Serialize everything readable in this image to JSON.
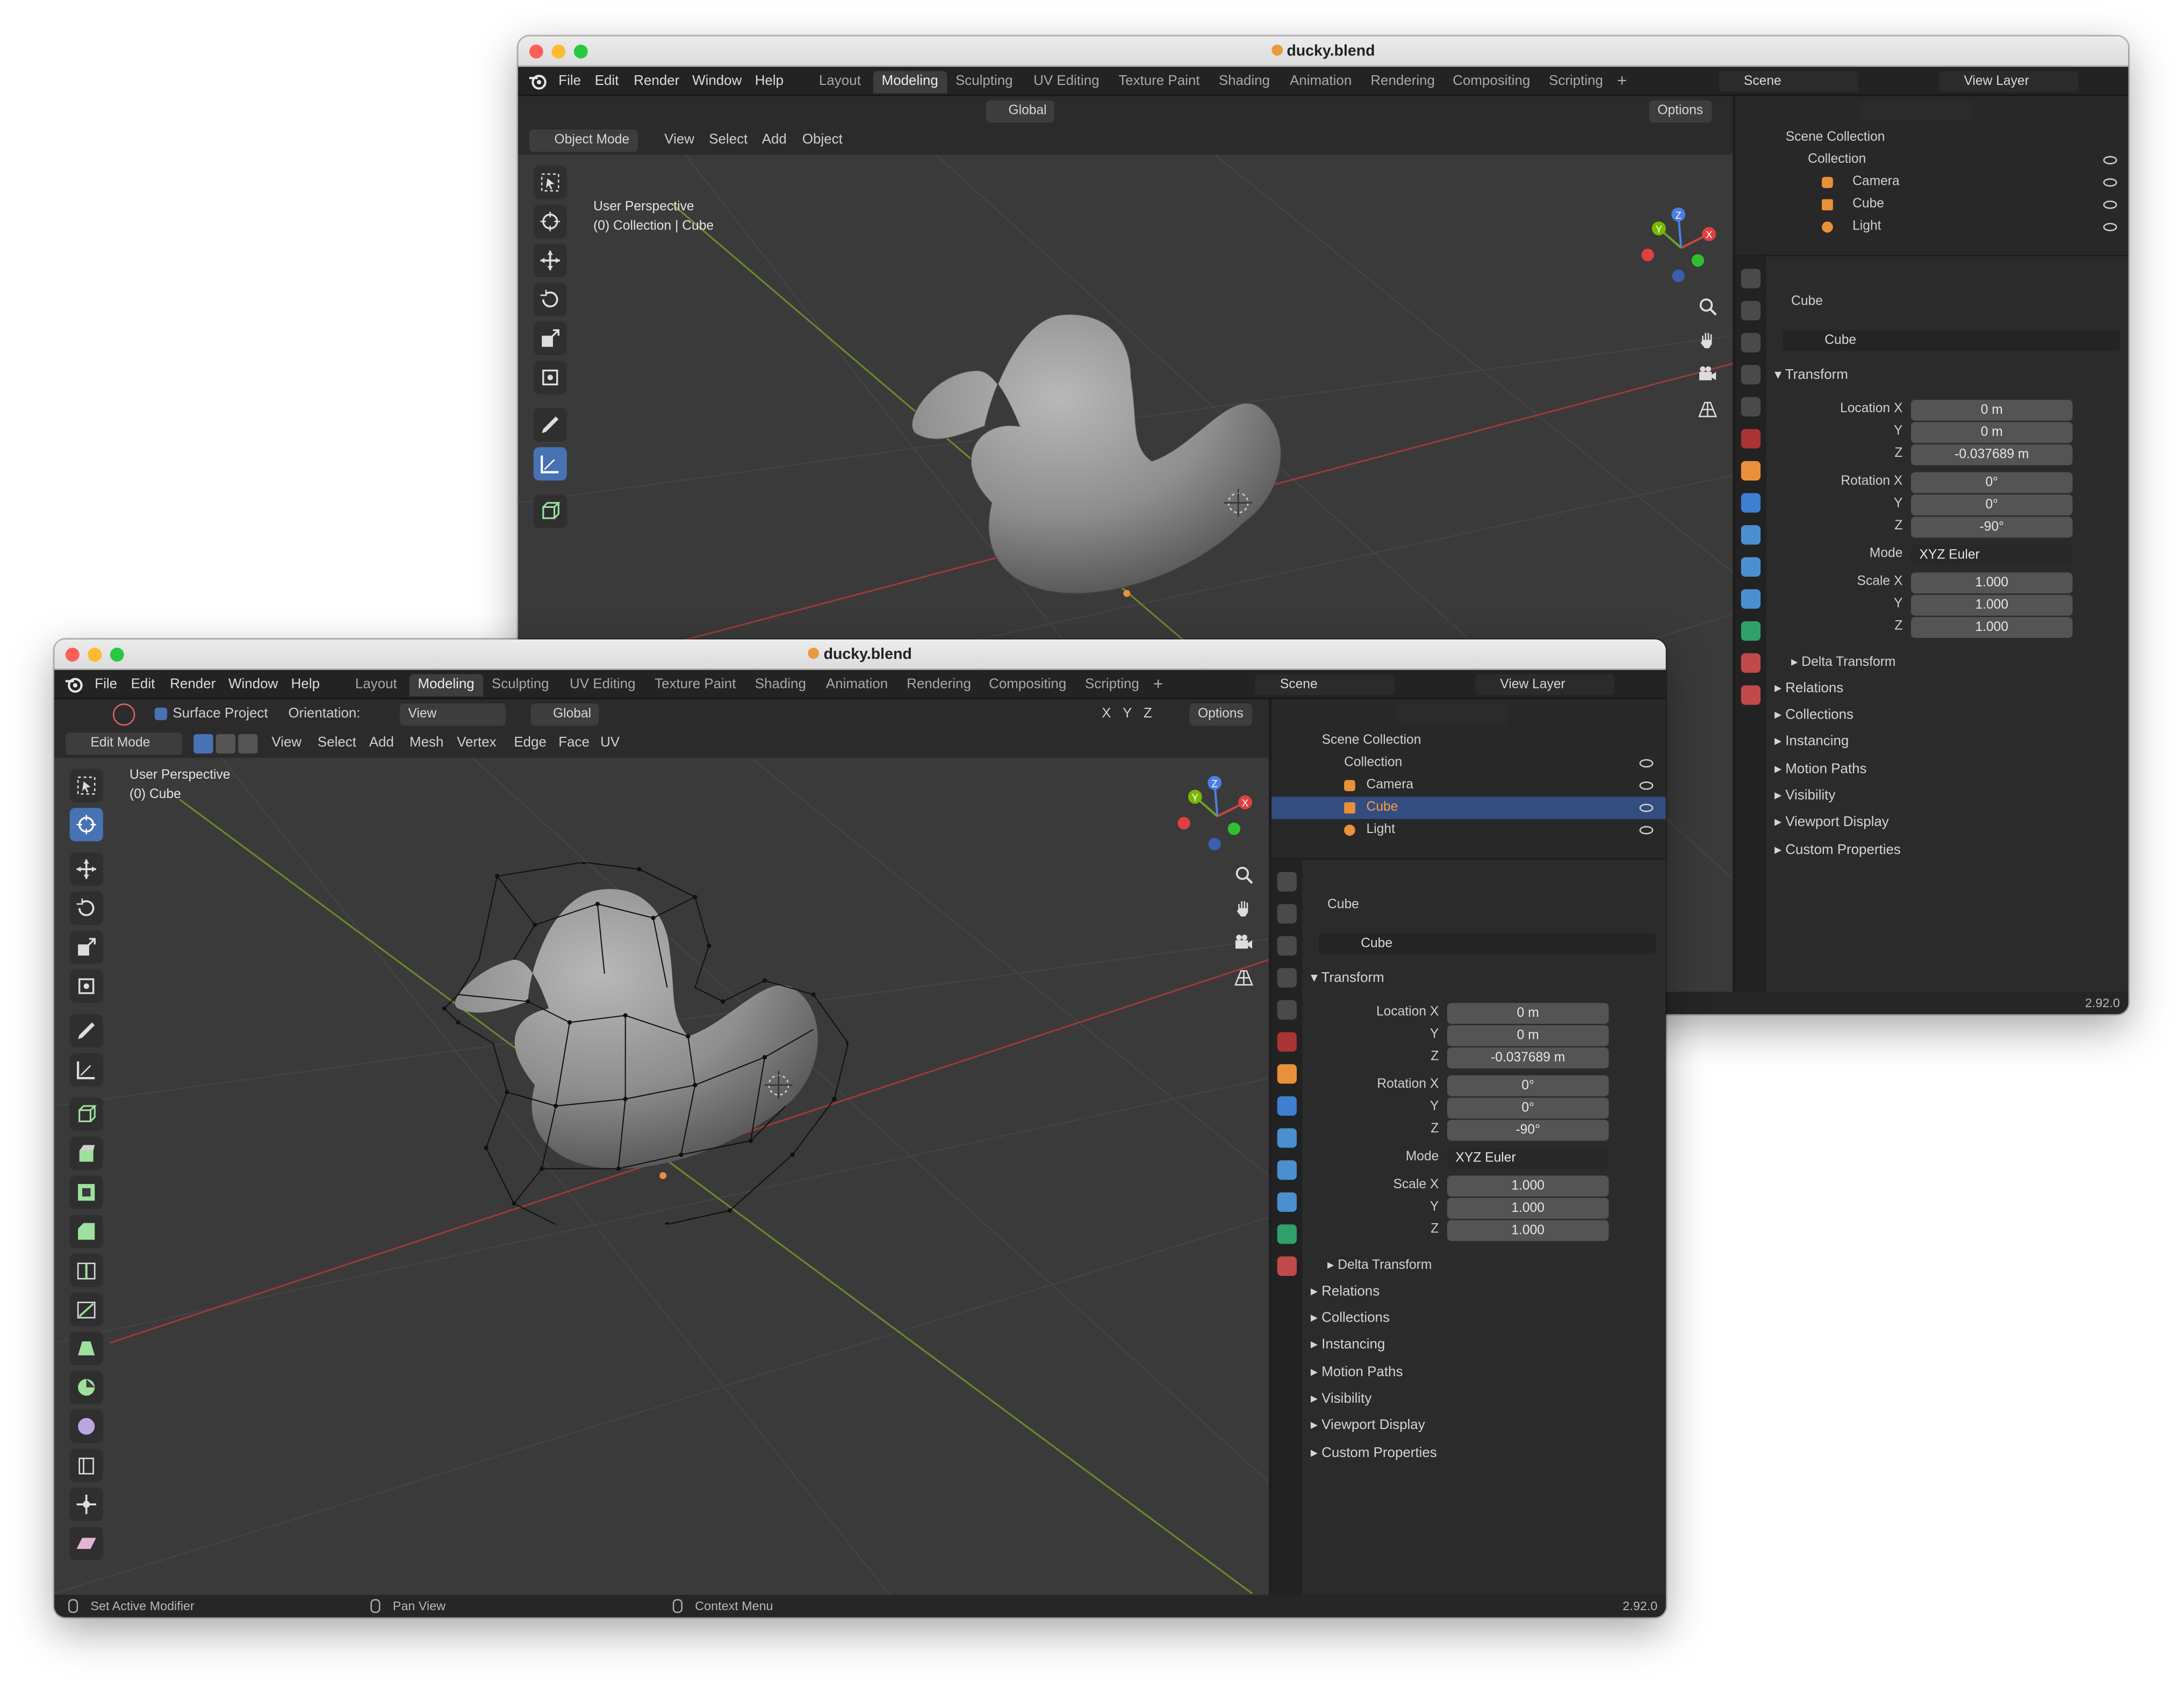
{
  "back": {
    "title": "ducky.blend",
    "menus": [
      "File",
      "Edit",
      "Render",
      "Window",
      "Help"
    ],
    "tabs": [
      "Layout",
      "Modeling",
      "Sculpting",
      "UV Editing",
      "Texture Paint",
      "Shading",
      "Animation",
      "Rendering",
      "Compositing",
      "Scripting"
    ],
    "active_tab": "Modeling",
    "scene": "Scene",
    "view_layer": "View Layer",
    "transform_orientation": "Global",
    "options": "Options",
    "mode": "Object Mode",
    "header_menus": [
      "View",
      "Select",
      "Add",
      "Object"
    ],
    "vp_line1": "User Perspective",
    "vp_line2": "(0) Collection | Cube",
    "outliner": {
      "scene_collection": "Scene Collection",
      "collection": "Collection",
      "items": [
        "Camera",
        "Cube",
        "Light"
      ]
    },
    "props": {
      "object_name": "Cube",
      "data_name": "Cube",
      "transform": "Transform",
      "location_label": "Location X",
      "loc": [
        "0 m",
        "0 m",
        "-0.037689 m"
      ],
      "rotation_label": "Rotation X",
      "rot": [
        "0°",
        "0°",
        "-90°"
      ],
      "mode_label": "Mode",
      "mode_value": "XYZ Euler",
      "scale_label": "Scale X",
      "scale": [
        "1.000",
        "1.000",
        "1.000"
      ],
      "y": "Y",
      "z": "Z",
      "delta": "Delta Transform",
      "sections": [
        "Relations",
        "Collections",
        "Instancing",
        "Motion Paths",
        "Visibility",
        "Viewport Display",
        "Custom Properties"
      ]
    },
    "version": "2.92.0"
  },
  "front": {
    "title": "ducky.blend",
    "menus": [
      "File",
      "Edit",
      "Render",
      "Window",
      "Help"
    ],
    "tabs": [
      "Layout",
      "Modeling",
      "Sculpting",
      "UV Editing",
      "Texture Paint",
      "Shading",
      "Animation",
      "Rendering",
      "Compositing",
      "Scripting"
    ],
    "active_tab": "Modeling",
    "scene": "Scene",
    "view_layer": "View Layer",
    "surface_project": "Surface Project",
    "orientation_label": "Orientation:",
    "orientation_value": "View",
    "transform_orientation": "Global",
    "xyz": [
      "X",
      "Y",
      "Z"
    ],
    "options": "Options",
    "mode": "Edit Mode",
    "header_menus": [
      "View",
      "Select",
      "Add",
      "Mesh",
      "Vertex",
      "Edge",
      "Face",
      "UV"
    ],
    "vp_line1": "User Perspective",
    "vp_line2": "(0) Cube",
    "outliner": {
      "scene_collection": "Scene Collection",
      "collection": "Collection",
      "items": [
        "Camera",
        "Cube",
        "Light"
      ]
    },
    "props": {
      "object_name": "Cube",
      "data_name": "Cube",
      "transform": "Transform",
      "location_label": "Location X",
      "loc": [
        "0 m",
        "0 m",
        "-0.037689 m"
      ],
      "rotation_label": "Rotation X",
      "rot": [
        "0°",
        "0°",
        "-90°"
      ],
      "mode_label": "Mode",
      "mode_value": "XYZ Euler",
      "scale_label": "Scale X",
      "scale": [
        "1.000",
        "1.000",
        "1.000"
      ],
      "y": "Y",
      "z": "Z",
      "delta": "Delta Transform",
      "sections": [
        "Relations",
        "Collections",
        "Instancing",
        "Motion Paths",
        "Visibility",
        "Viewport Display",
        "Custom Properties"
      ]
    },
    "status": [
      "Set Active Modifier",
      "Pan View",
      "Context Menu"
    ],
    "version": "2.92.0"
  },
  "colors": {
    "accent": "#4772b3",
    "selection": "#334d80",
    "object_orange": "#e8913a",
    "x_axis": "#e04040",
    "y_axis": "#7ab800",
    "z_axis": "#4a7fe0"
  },
  "icons": [
    "blender-logo-icon",
    "select-box-icon",
    "cursor-icon",
    "move-icon",
    "rotate-icon",
    "scale-icon",
    "transform-icon",
    "annotate-icon",
    "measure-icon",
    "add-cube-icon",
    "extrude-icon",
    "inset-icon",
    "bevel-icon",
    "loop-cut-icon",
    "knife-icon",
    "poly-build-icon",
    "spin-icon",
    "smooth-icon",
    "edge-slide-icon",
    "shrink-icon",
    "shear-icon",
    "zoom-icon",
    "hand-icon",
    "camera-icon",
    "grid-icon",
    "eye-icon",
    "camera-object-icon",
    "mesh-object-icon",
    "light-object-icon",
    "pin-icon",
    "lock-icon"
  ]
}
